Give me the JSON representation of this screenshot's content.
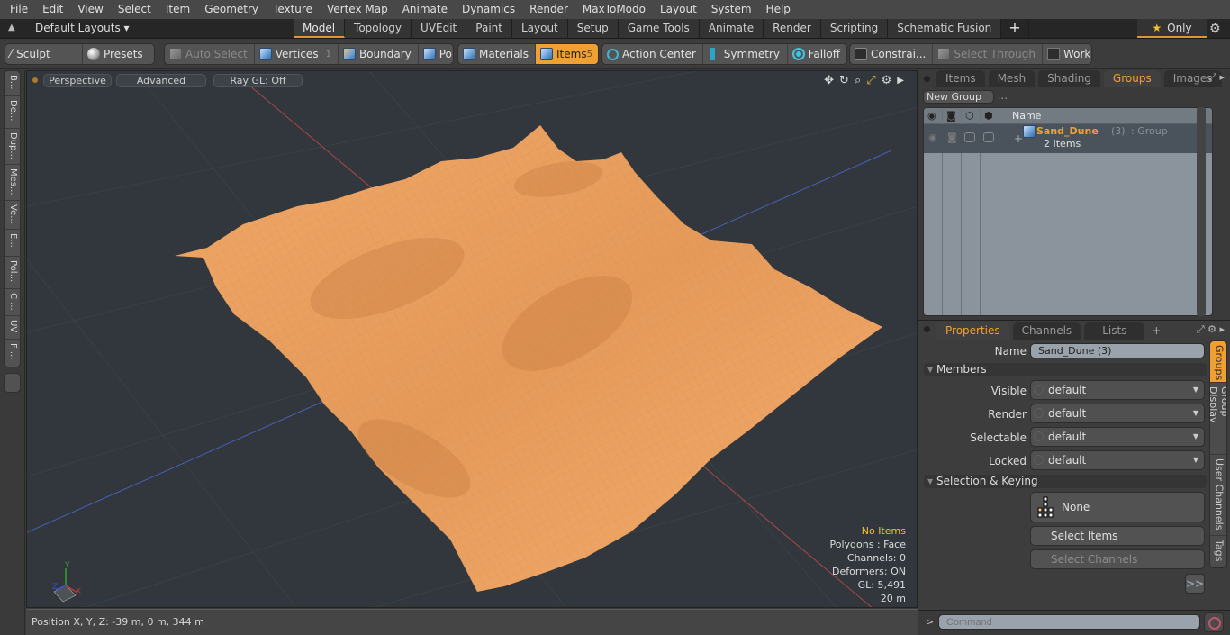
{
  "menubar": {
    "items": [
      "File",
      "Edit",
      "View",
      "Select",
      "Item",
      "Geometry",
      "Texture",
      "Vertex Map",
      "Animate",
      "Dynamics",
      "Render",
      "MaxToModo",
      "Layout",
      "System",
      "Help"
    ]
  },
  "layoutbar": {
    "layout_selector": "Default Layouts ▾",
    "tabs": [
      "Model",
      "Topology",
      "UVEdit",
      "Paint",
      "Layout",
      "Setup",
      "Game Tools",
      "Animate",
      "Render",
      "Scripting",
      "Schematic Fusion"
    ],
    "active_tab": "Model",
    "add_tab": "+",
    "only_label": "Only",
    "only_icon": "star-icon"
  },
  "toolbar": {
    "sculpt": "Sculpt",
    "presets": "Presets",
    "auto_select": "Auto Select",
    "vertices": "Vertices",
    "vertices_count": "1",
    "boundary": "Boundary",
    "polygons": "Polygons",
    "materials": "Materials",
    "items": "Items",
    "items_count": "5",
    "action_center": "Action Center",
    "symmetry": "Symmetry",
    "falloff": "Falloff",
    "constraints": "Constrai...",
    "select_through": "Select Through",
    "workplane": "WorkPlane",
    "accent_color": "#f0a032"
  },
  "left_tabs": [
    "B...",
    "De...",
    "Dup...",
    "Mes...",
    "Ve...",
    "E...",
    "Pol...",
    "C ...",
    "UV",
    "F ..."
  ],
  "viewport": {
    "view_mode": "Perspective",
    "shading": "Advanced",
    "raygl": "Ray GL: Off",
    "icons": [
      "move-view-icon",
      "rotate-view-icon",
      "zoom-view-icon",
      "maximize-icon",
      "viewport-settings-icon",
      "expand-arrow-icon"
    ],
    "info": {
      "selection": "No Items",
      "polygons": "Polygons : Face",
      "channels": "Channels: 0",
      "deformers": "Deformers: ON",
      "gl": "GL: 5,491",
      "scale": "20 m"
    },
    "mesh_color": "#f4a460",
    "axis_labels": {
      "x": "X",
      "y": "Y",
      "z": "Z"
    }
  },
  "statusbar": {
    "position": "Position X, Y, Z:   -39 m, 0 m, 344 m"
  },
  "groups_panel": {
    "tabs": [
      "Items",
      "Mesh ...",
      "Shading",
      "Groups",
      "Images"
    ],
    "active_tab": "Groups",
    "new_group": "New Group",
    "column_name": "Name",
    "rows": [
      {
        "name": "Sand_Dune",
        "count": "(3)",
        "type": ": Group",
        "sub": "2 Items"
      }
    ]
  },
  "properties_panel": {
    "tabs": [
      "Properties",
      "Channels",
      "Lists"
    ],
    "active_tab": "Properties",
    "name_label": "Name",
    "name_value": "Sand_Dune (3)",
    "members_section": "Members",
    "fields": [
      {
        "label": "Visible",
        "value": "default"
      },
      {
        "label": "Render",
        "value": "default"
      },
      {
        "label": "Selectable",
        "value": "default"
      },
      {
        "label": "Locked",
        "value": "default"
      }
    ],
    "selection_section": "Selection & Keying",
    "keying_value": "None",
    "select_items": "Select Items",
    "select_channels": "Select Channels",
    "more": ">>",
    "side_tabs": [
      "Groups",
      "Group Display",
      "User Channels",
      "Tags"
    ],
    "active_side_tab": "Groups"
  },
  "command": {
    "prompt": ">",
    "placeholder": "Command"
  }
}
